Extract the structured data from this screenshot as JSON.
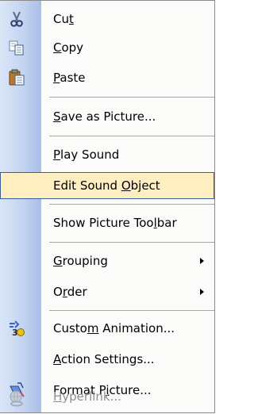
{
  "menu": {
    "items": [
      {
        "id": "cut",
        "pre": "Cu",
        "u": "t",
        "post": "",
        "icon": "scissors-icon"
      },
      {
        "id": "copy",
        "pre": "",
        "u": "C",
        "post": "opy",
        "icon": "copy-icon"
      },
      {
        "id": "paste",
        "pre": "",
        "u": "P",
        "post": "aste",
        "icon": "paste-clipboard-icon"
      },
      {
        "id": "save-as-picture",
        "pre": "",
        "u": "S",
        "post": "ave as Picture..."
      },
      {
        "id": "play-sound",
        "pre": "",
        "u": "P",
        "post": "lay Sound"
      },
      {
        "id": "edit-sound-object",
        "pre": "Edit Sound ",
        "u": "O",
        "post": "bject",
        "selected": true
      },
      {
        "id": "show-picture-toolbar",
        "pre": "Show Picture Too",
        "u": "l",
        "post": "bar"
      },
      {
        "id": "grouping",
        "pre": "",
        "u": "G",
        "post": "rouping",
        "submenu": true
      },
      {
        "id": "order",
        "pre": "O",
        "u": "r",
        "post": "der",
        "submenu": true
      },
      {
        "id": "custom-animation",
        "pre": "Custo",
        "u": "m",
        "post": " Animation...",
        "icon": "custom-animation-icon"
      },
      {
        "id": "action-settings",
        "pre": "",
        "u": "A",
        "post": "ction Settings..."
      },
      {
        "id": "format-picture",
        "pre": "Format P",
        "u": "i",
        "post": "cture...",
        "icon": "format-picture-icon"
      },
      {
        "id": "hyperlink",
        "pre": "",
        "u": "H",
        "post": "yperlink...",
        "icon": "hyperlink-globe-icon",
        "disabled": true
      }
    ]
  }
}
